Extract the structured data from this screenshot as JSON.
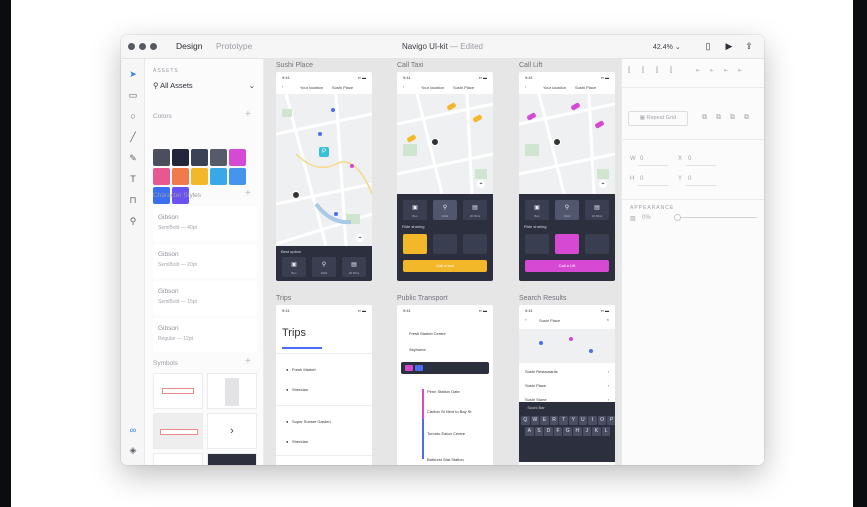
{
  "window": {
    "title": "Navigo UI-kit",
    "title_sep": "—",
    "edited": "Edited",
    "mode_tabs": [
      "Design",
      "Prototype"
    ],
    "zoom": "42.4%",
    "zoom_caret": "⌄"
  },
  "toolbar": {
    "tools": [
      "select-arrow-icon",
      "rectangle-icon",
      "ellipse-icon",
      "line-icon",
      "pen-icon",
      "text-icon",
      "artboard-icon",
      "zoom-icon"
    ],
    "bottom_tools": [
      "link-icon",
      "layers-icon"
    ]
  },
  "assets": {
    "header": "ASSETS",
    "all_assets": "All Assets",
    "colors_title": "Colors",
    "colors": [
      "#4a4e5f",
      "#23263a",
      "#3c4256",
      "#565b6c",
      "#d64ad3",
      "#e8578f",
      "#f07a4b",
      "#f3b829",
      "#38a8e9",
      "#4595ee",
      "#3a6ff2",
      "#6a52f0"
    ],
    "character_styles_title": "Character Styles",
    "character_styles": [
      {
        "name": "Gibson",
        "meta": "SemiBold — 40pt"
      },
      {
        "name": "Gibson",
        "meta": "SemiBold — 20pt"
      },
      {
        "name": "Gibson",
        "meta": "SemiBold — 15pt"
      },
      {
        "name": "Gibson",
        "meta": "Regular — 12pt"
      }
    ],
    "symbols_title": "Symbols"
  },
  "canvas": {
    "artboards": [
      {
        "title": "Sushi Place",
        "nav_left": "Your location",
        "nav_right": "Sushi Place",
        "panel_title": "Best option",
        "modes": [
          "Bus",
          "Walk",
          "20 Mins"
        ]
      },
      {
        "title": "Call Taxi",
        "nav_left": "Your location",
        "nav_right": "Sushi Place",
        "panel_title": "Ride sharing",
        "modes": [
          "Bus",
          "Walk",
          "20 Mins"
        ],
        "cta": "Call a taxi"
      },
      {
        "title": "Call Lift",
        "nav_left": "Your location",
        "nav_right": "Sushi Place",
        "panel_title": "Ride sharing",
        "modes": [
          "Bus",
          "Walk",
          "20 Mins"
        ],
        "cta": "Call a Lift"
      },
      {
        "title": "Trips",
        "heading": "Trips",
        "items": [
          "Fresh Market",
          "Sheridan",
          "Super Sunset Garden",
          "Sheridan"
        ]
      },
      {
        "title": "Public Transport",
        "from": "Fresh Market Centre",
        "to": "Skyhome",
        "stops": [
          "Penn Station Gate",
          "Carlton St Next to Bay St",
          "Toronto Eaton Centre",
          "Bathurst Stat Station"
        ]
      },
      {
        "title": "Search Results",
        "query": "Sushi Place",
        "results": [
          "Sushi Restaurants",
          "Sushi Place",
          "Sushi Stone",
          "Sushi Bar"
        ],
        "keys_row1": [
          "Q",
          "W",
          "E",
          "R",
          "T",
          "Y",
          "U",
          "I",
          "O",
          "P"
        ],
        "keys_row2": [
          "A",
          "S",
          "D",
          "F",
          "G",
          "H",
          "J",
          "K",
          "L"
        ]
      }
    ]
  },
  "properties": {
    "repeat_grid": "Repeat Grid",
    "w_label": "W",
    "w_value": "0",
    "x_label": "X",
    "x_value": "0",
    "h_label": "H",
    "h_value": "0",
    "y_label": "Y",
    "y_value": "0",
    "appearance": "APPEARANCE",
    "opacity": "0%"
  }
}
